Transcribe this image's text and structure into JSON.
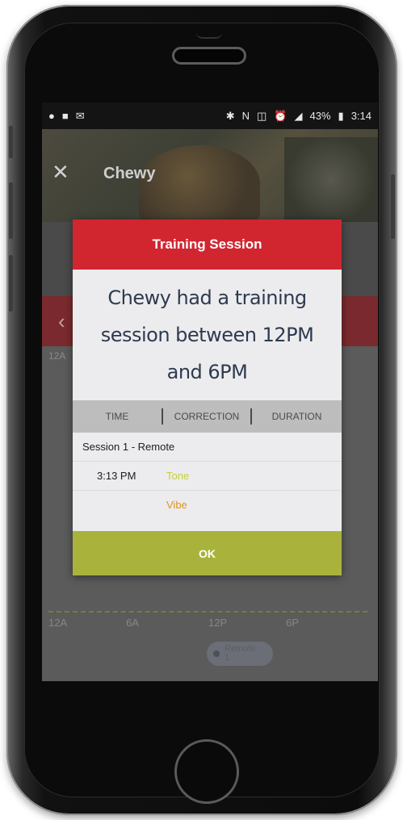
{
  "status_bar": {
    "left_icons": [
      "chat-bubble-icon",
      "image-icon",
      "envelope-icon"
    ],
    "right_icons": [
      "bluetooth-icon",
      "nfc-icon",
      "vibrate-icon",
      "alarm-icon",
      "signal-icon"
    ],
    "battery": "43%",
    "time": "3:14"
  },
  "header": {
    "title": "Chewy"
  },
  "background_chart": {
    "top_tick": "12A",
    "axis_ticks": [
      "12A",
      "6A",
      "12P",
      "6P"
    ],
    "pill_label": "Remote",
    "pill_count": "1"
  },
  "modal": {
    "title": "Training Session",
    "message": "Chewy had a training session between 12PM and 6PM",
    "columns": [
      "TIME",
      "CORRECTION",
      "DURATION"
    ],
    "session_label": "Session 1 - Remote",
    "entries": [
      {
        "time": "3:13 PM",
        "correction": "Tone",
        "color": "#c7cf3a"
      },
      {
        "time": "",
        "correction": "Vibe",
        "color": "#e0921e"
      }
    ],
    "ok_label": "OK"
  },
  "colors": {
    "modal_header": "#d12630",
    "ok_button": "#a9b33c",
    "tone": "#c7cf3a",
    "vibe": "#e0921e"
  }
}
